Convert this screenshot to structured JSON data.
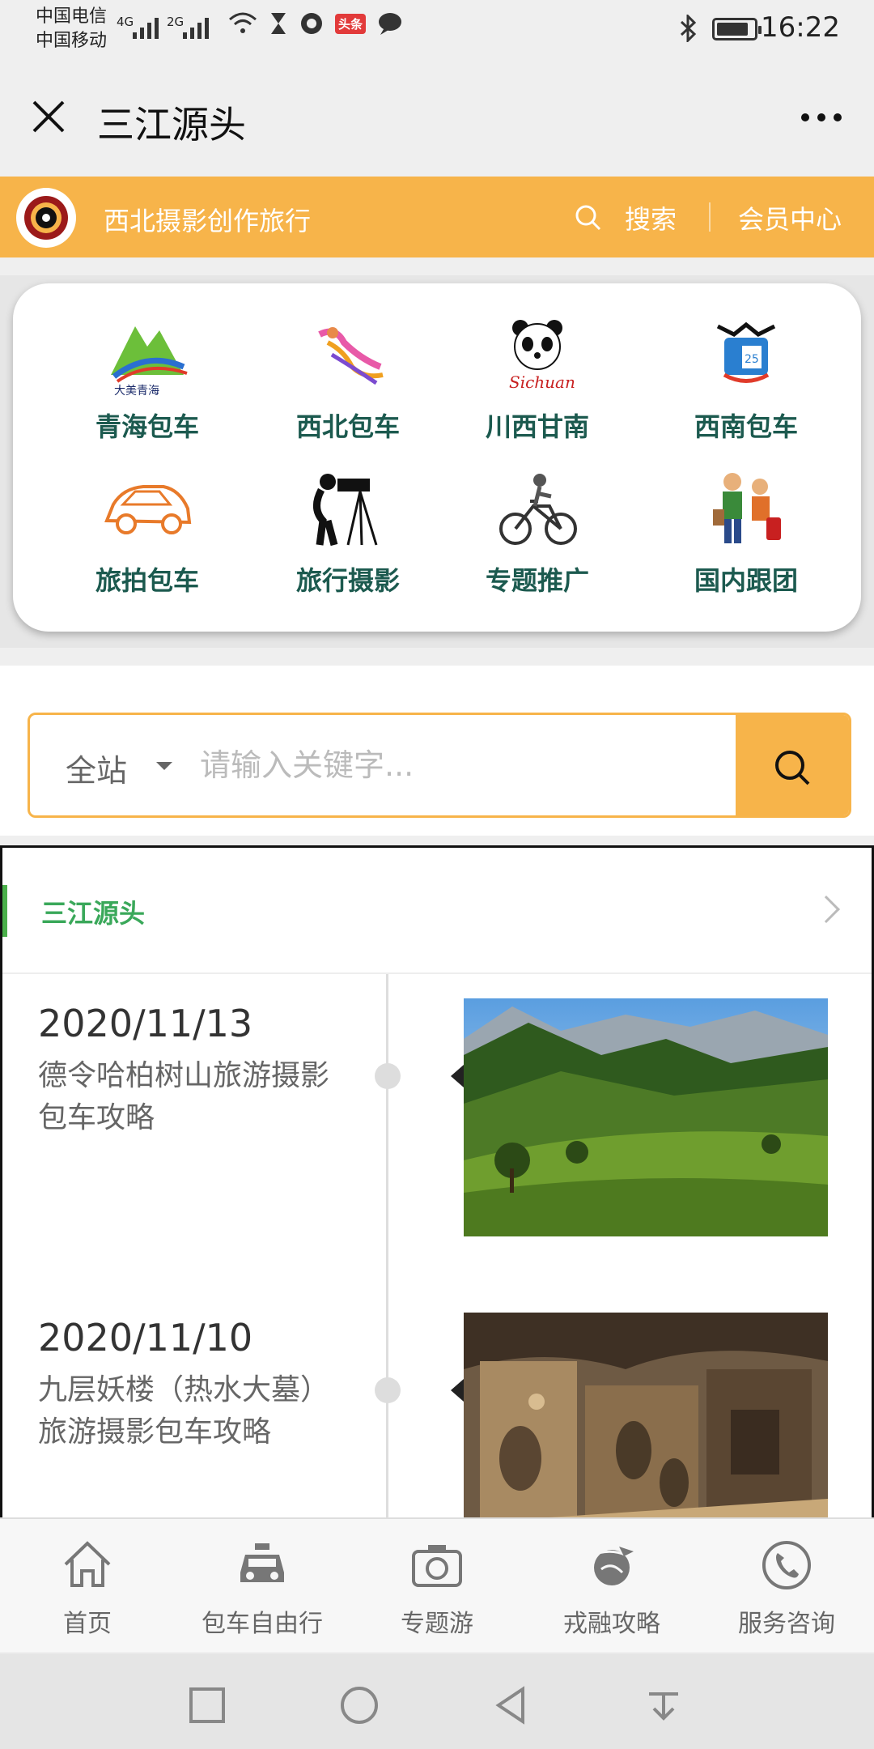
{
  "status_bar": {
    "carrier_1": "中国电信",
    "carrier_2": "中国移动",
    "net_1": "4G",
    "net_2": "2G",
    "toutiao_badge": "头条",
    "time": "16:22"
  },
  "title_bar": {
    "title": "三江源头"
  },
  "header": {
    "site_name": "西北摄影创作旅行",
    "search_label": "搜索",
    "member_label": "会员中心",
    "accent": "#f7b44a"
  },
  "categories": [
    {
      "label": "青海包车",
      "icon": "qinghai-icon"
    },
    {
      "label": "西北包车",
      "icon": "northwest-icon"
    },
    {
      "label": "川西甘南",
      "icon": "panda-icon"
    },
    {
      "label": "西南包车",
      "icon": "southwest-icon"
    },
    {
      "label": "旅拍包车",
      "icon": "car-icon"
    },
    {
      "label": "旅行摄影",
      "icon": "camera-tripod-icon"
    },
    {
      "label": "专题推广",
      "icon": "bicycle-icon"
    },
    {
      "label": "国内跟团",
      "icon": "tour-group-icon"
    }
  ],
  "search": {
    "scope": "全站",
    "placeholder": "请输入关键字..."
  },
  "section": {
    "title": "三江源头",
    "accent": "#3aa85a"
  },
  "articles": [
    {
      "date": "2020/11/13",
      "desc": "德令哈柏树山旅游摄影包车攻略",
      "image": "green-mountain-photo"
    },
    {
      "date": "2020/11/10",
      "desc": "九层妖楼（热水大墓）旅游摄影包车攻略",
      "image": "ancient-tomb-photo"
    }
  ],
  "tabs": [
    {
      "label": "首页",
      "icon": "home-icon"
    },
    {
      "label": "包车自由行",
      "icon": "taxi-icon"
    },
    {
      "label": "专题游",
      "icon": "camera-icon"
    },
    {
      "label": "戎融攻略",
      "icon": "globe-plane-icon"
    },
    {
      "label": "服务咨询",
      "icon": "phone-icon"
    }
  ]
}
